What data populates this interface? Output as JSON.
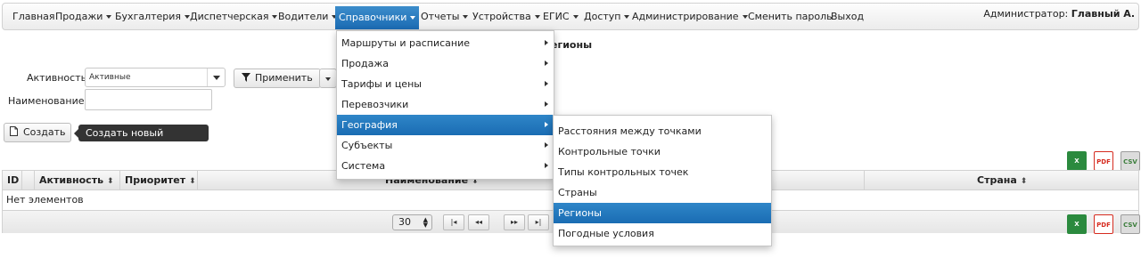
{
  "nav": {
    "items": [
      {
        "label": "Главная",
        "caret": false
      },
      {
        "label": "Продажи",
        "caret": true
      },
      {
        "label": "Бухгалтерия",
        "caret": true
      },
      {
        "label": "Диспетчерская",
        "caret": true
      },
      {
        "label": "Водители",
        "caret": true
      },
      {
        "label": "Справочники",
        "caret": true,
        "active": true
      },
      {
        "label": "Отчеты",
        "caret": true
      },
      {
        "label": "Устройства",
        "caret": true
      },
      {
        "label": "ЕГИС",
        "caret": true
      },
      {
        "label": "Доступ",
        "caret": true
      },
      {
        "label": "Администрирование",
        "caret": true
      },
      {
        "label": "Сменить пароль",
        "caret": false
      },
      {
        "label": "Выход",
        "caret": false
      }
    ],
    "user_role": "Администратор:",
    "user_name": "Главный А."
  },
  "page_title": "егионы",
  "filters": {
    "activity_label": "Активность",
    "activity_value": "Активные",
    "name_label": "Наименование",
    "apply_label": "Применить"
  },
  "toolbar": {
    "create_label": "Создать",
    "create_tooltip": "Создать новый элемент"
  },
  "grid": {
    "columns": [
      "ID",
      "Активность",
      "Приоритет",
      "Наименование",
      "Страна"
    ],
    "sort_glyph": "⬍",
    "empty_text": "Нет элементов",
    "page_size": "30",
    "pager": {
      "first": "|◂",
      "prev": "◂◂",
      "next": "▸▸",
      "last": "▸|"
    }
  },
  "export": {
    "xls": "X",
    "pdf": "PDF",
    "csv": "CSV"
  },
  "menu": {
    "items": [
      {
        "label": "Маршруты и расписание"
      },
      {
        "label": "Продажа"
      },
      {
        "label": "Тарифы и цены"
      },
      {
        "label": "Перевозчики"
      },
      {
        "label": "География",
        "highlighted": true
      },
      {
        "label": "Субъекты"
      },
      {
        "label": "Система"
      }
    ],
    "submenu": [
      {
        "label": "Расстояния между точками"
      },
      {
        "label": "Контрольные точки"
      },
      {
        "label": "Типы контрольных точек"
      },
      {
        "label": "Страны"
      },
      {
        "label": "Регионы",
        "highlighted": true
      },
      {
        "label": "Погодные условия"
      }
    ]
  },
  "colors": {
    "accent": "#1b6bb3",
    "tooltip": "#333333"
  }
}
